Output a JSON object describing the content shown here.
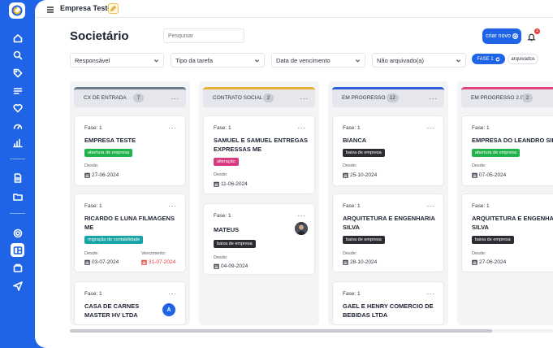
{
  "header": {
    "company": "Empresa Teste",
    "title": "Societário",
    "search_placeholder": "Pesquisar",
    "new_button": "criar novo",
    "notifications_count": "4"
  },
  "filters": {
    "responsavel": "Responsável",
    "tipo_tarefa": "Tipo da tarefa",
    "vencimento": "Data de vencimento",
    "arquivado": "Não arquivado(a)",
    "phase_chip": "FASE 1",
    "archived_chip": "arquivados"
  },
  "colors": {
    "primary": "#1f64e6",
    "tag_green": "#22b24c",
    "tag_black": "#2b2d33",
    "tag_pink": "#d83a7f",
    "tag_teal": "#19a5a5",
    "overdue": "#e53935"
  },
  "columns": [
    {
      "title": "CX DE ENTRADA",
      "count": "7",
      "accent": "#6b7b8c",
      "cards": [
        {
          "phase": "Fase: 1",
          "title": "EMPRESA TESTE",
          "tag": "abertura de empresa",
          "since_label": "Desde:",
          "since": "27-06-2024"
        },
        {
          "phase": "Fase: 1",
          "title": "RICARDO E LUNA FILMAGENS ME",
          "tag": "migração de contabilidade",
          "since_label": "Desde:",
          "since": "03-07-2024",
          "due_label": "Vencimento:",
          "due": "31-07-2024"
        },
        {
          "phase": "Fase: 1",
          "title": "CASA DE CARNES MASTER HV LTDA",
          "avatar": "A"
        }
      ]
    },
    {
      "title": "CONTRATO SOCIAL",
      "count": "2",
      "accent": "#e8b13a",
      "cards": [
        {
          "phase": "Fase: 1",
          "title": "SAMUEL E SAMUEL ENTREGAS EXPRESSAS ME",
          "tag": "alteração",
          "since_label": "Desde:",
          "since": "11-06-2024"
        },
        {
          "phase": "Fase: 1",
          "title": "MATEUS",
          "tag": "baixa de empresa",
          "since_label": "Desde:",
          "since": "04-09-2024"
        }
      ]
    },
    {
      "title": "EM PROGRESSO",
      "count": "12",
      "accent": "#2d5fd6",
      "cards": [
        {
          "phase": "Fase: 1",
          "title": "BIANCA",
          "tag": "baixa de empresa",
          "since_label": "Desde:",
          "since": "25-10-2024"
        },
        {
          "phase": "Fase: 1",
          "title": "ARQUITETURA E ENGENHARIA SILVA",
          "tag": "baixa de empresa",
          "since_label": "Desde:",
          "since": "28-10-2024"
        },
        {
          "phase": "Fase: 1",
          "title": "GAEL E HENRY COMERCIO DE BEBIDAS LTDA"
        }
      ]
    },
    {
      "title": "EM PROGRESSO 2.0",
      "count": "2",
      "accent": "#e0457b",
      "cards": [
        {
          "phase": "Fase: 1",
          "title": "EMPRESA DO LEANDRO SILVA",
          "tag": "abertura de empresa",
          "since_label": "Desde:",
          "since": "07-05-2024"
        },
        {
          "phase": "Fase: 1",
          "title": "ARQUITETURA E ENGENHARIA SILVA",
          "tag": "baixa de empresa",
          "since_label": "Desde:",
          "since": "27-06-2024"
        }
      ]
    }
  ]
}
